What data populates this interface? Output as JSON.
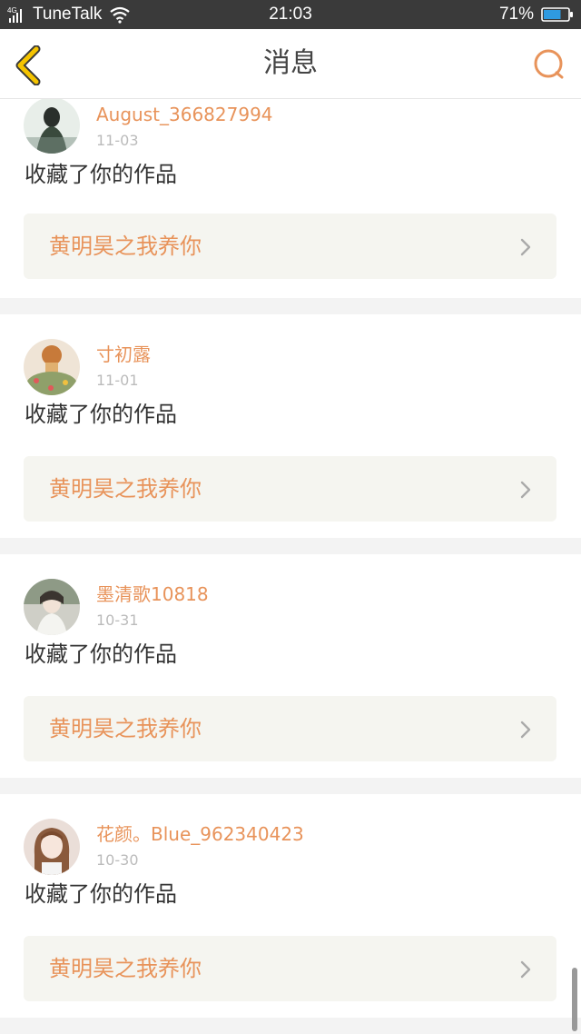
{
  "status_bar": {
    "network": "4G",
    "carrier": "TuneTalk",
    "time": "21:03",
    "battery": "71%",
    "battery_level": 0.71
  },
  "nav": {
    "title": "消息",
    "back_icon": "chevron-left-icon",
    "search_icon": "search-icon",
    "accent": "#f5c400"
  },
  "notifications": [
    {
      "user": "August_366827994",
      "date": "11-03",
      "action": "收藏了你的作品",
      "work": "黄明昊之我养你",
      "avatar_color": "#5b6b5e"
    },
    {
      "user": "寸初露",
      "date": "11-01",
      "action": "收藏了你的作品",
      "work": "黄明昊之我养你",
      "avatar_color": "#d88a4a"
    },
    {
      "user": "墨清歌10818",
      "date": "10-31",
      "action": "收藏了你的作品",
      "work": "黄明昊之我养你",
      "avatar_color": "#6d6a63"
    },
    {
      "user": "花颜。Blue_962340423",
      "date": "10-30",
      "action": "收藏了你的作品",
      "work": "黄明昊之我养你",
      "avatar_color": "#c9a99a"
    }
  ],
  "colors": {
    "accent_orange": "#e8935a",
    "background": "#f3f3f3",
    "work_box": "#f5f5f0"
  }
}
